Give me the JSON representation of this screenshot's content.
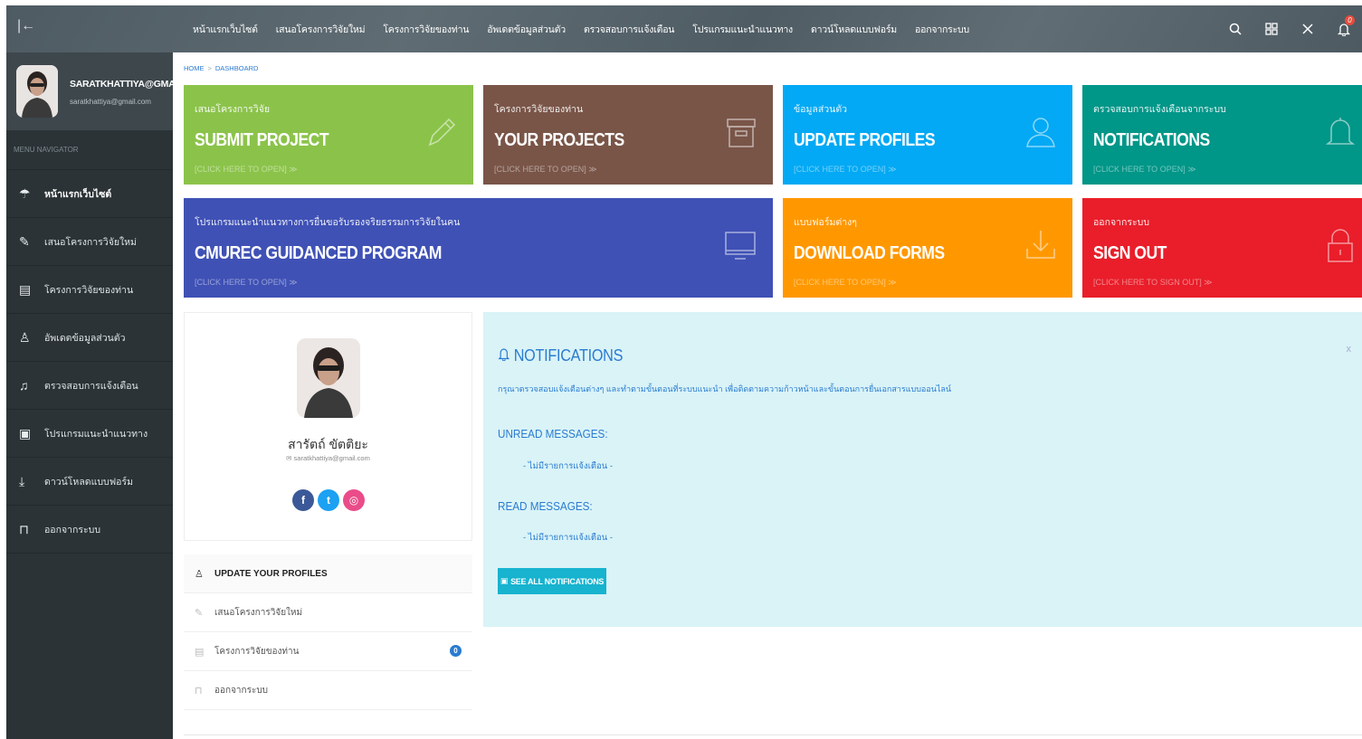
{
  "topbar": {
    "collapse_icon": "collapse-sidebar-icon",
    "nav": [
      "หน้าแรกเว็บไซต์",
      "เสนอโครงการวิจัยใหม่",
      "โครงการวิจัยของท่าน",
      "อัพเดตข้อมูลส่วนตัว",
      "ตรวจสอบการแจ้งเตือน",
      "โปรแกรมแนะนำแนวทาง",
      "ดาวน์โหลดแบบฟอร์ม",
      "ออกจากระบบ"
    ],
    "notification_count": "0",
    "icons": [
      "search-icon",
      "grid-icon",
      "fullscreen-icon",
      "bell-icon"
    ]
  },
  "sidebar": {
    "username": "SARATKHATTIYA@GMAIL.COM",
    "email": "saratkhattiya@gmail.com",
    "menu_head": "MENU NAVIGATOR",
    "items": [
      {
        "label": "หน้าแรกเว็บไซต์",
        "icon": "home-icon"
      },
      {
        "label": "เสนอโครงการวิจัยใหม่",
        "icon": "pencil-icon"
      },
      {
        "label": "โครงการวิจัยของท่าน",
        "icon": "archive-icon"
      },
      {
        "label": "อัพเดตข้อมูลส่วนตัว",
        "icon": "user-icon"
      },
      {
        "label": "ตรวจสอบการแจ้งเตือน",
        "icon": "bell-icon"
      },
      {
        "label": "โปรแกรมแนะนำแนวทาง",
        "icon": "monitor-icon"
      },
      {
        "label": "ดาวน์โหลดแบบฟอร์ม",
        "icon": "download-icon"
      },
      {
        "label": "ออกจากระบบ",
        "icon": "lock-icon"
      }
    ]
  },
  "breadcrumb": {
    "home": "HOME",
    "current": "DASHBOARD"
  },
  "tiles": [
    {
      "sub": "เสนอโครงการวิจัย",
      "title": "SUBMIT PROJECT",
      "open": "[CLICK HERE TO OPEN] ≫",
      "color": "#8bc34a",
      "icon": "pencil-icon"
    },
    {
      "sub": "โครงการวิจัยของท่าน",
      "title": "YOUR PROJECTS",
      "open": "[CLICK HERE TO OPEN] ≫",
      "color": "#795548",
      "icon": "archive-icon"
    },
    {
      "sub": "ข้อมูลส่วนตัว",
      "title": "UPDATE PROFILES",
      "open": "[CLICK HERE TO OPEN] ≫",
      "color": "#03a9f4",
      "icon": "user-icon"
    },
    {
      "sub": "ตรวจสอบการแจ้งเตือนจากระบบ",
      "title": "NOTIFICATIONS",
      "open": "[CLICK HERE TO OPEN] ≫",
      "color": "#009688",
      "icon": "bell-icon"
    },
    {
      "sub": "โปรแกรมแนะนำแนวทางการยื่นขอรับรองจริยธรรมการวิจัยในคน",
      "title": "CMUREC GUIDANCED PROGRAM",
      "open": "[CLICK HERE TO OPEN] ≫",
      "color": "#3f51b5",
      "icon": "monitor-icon"
    },
    {
      "sub": "แบบฟอร์มต่างๆ",
      "title": "DOWNLOAD FORMS",
      "open": "[CLICK HERE TO OPEN] ≫",
      "color": "#ff9800",
      "icon": "download-icon"
    },
    {
      "sub": "ออกจากระบบ",
      "title": "SIGN OUT",
      "open": "[CLICK HERE TO SIGN OUT] ≫",
      "color": "#e91e2a",
      "icon": "lock-icon"
    }
  ],
  "profile_card": {
    "name": "สารัตถ์ ขัตติยะ",
    "email": "saratkhattiya@gmail.com",
    "socials": [
      {
        "icon": "facebook-icon",
        "glyph": "f",
        "color": "#3b5998"
      },
      {
        "icon": "twitter-icon",
        "glyph": "t",
        "color": "#1da1f2"
      },
      {
        "icon": "dribbble-icon",
        "glyph": "◎",
        "color": "#ea4c89"
      }
    ]
  },
  "profile_links": {
    "head": "UPDATE YOUR PROFILES",
    "items": [
      {
        "label": "เสนอโครงการวิจัยใหม่",
        "icon": "pencil-icon"
      },
      {
        "label": "โครงการวิจัยของท่าน",
        "icon": "archive-icon",
        "count": "0"
      },
      {
        "label": "ออกจากระบบ",
        "icon": "lock-icon"
      }
    ]
  },
  "notifications": {
    "title": "NOTIFICATIONS",
    "close": "x",
    "description": "กรุณาตรวจสอบแจ้งเตือนต่างๆ และทำตามขั้นตอนที่ระบบแนะนำ เพื่อติดตามความก้าวหน้าและขั้นตอนการยื่นเอกสารแบบออนไลน์",
    "unread_label": "UNREAD MESSAGES:",
    "unread_none": "- ไม่มีรายการแจ้งเตือน -",
    "read_label": "READ MESSAGES:",
    "read_none": "- ไม่มีรายการแจ้งเตือน -",
    "button": "SEE ALL NOTIFICATIONS"
  }
}
